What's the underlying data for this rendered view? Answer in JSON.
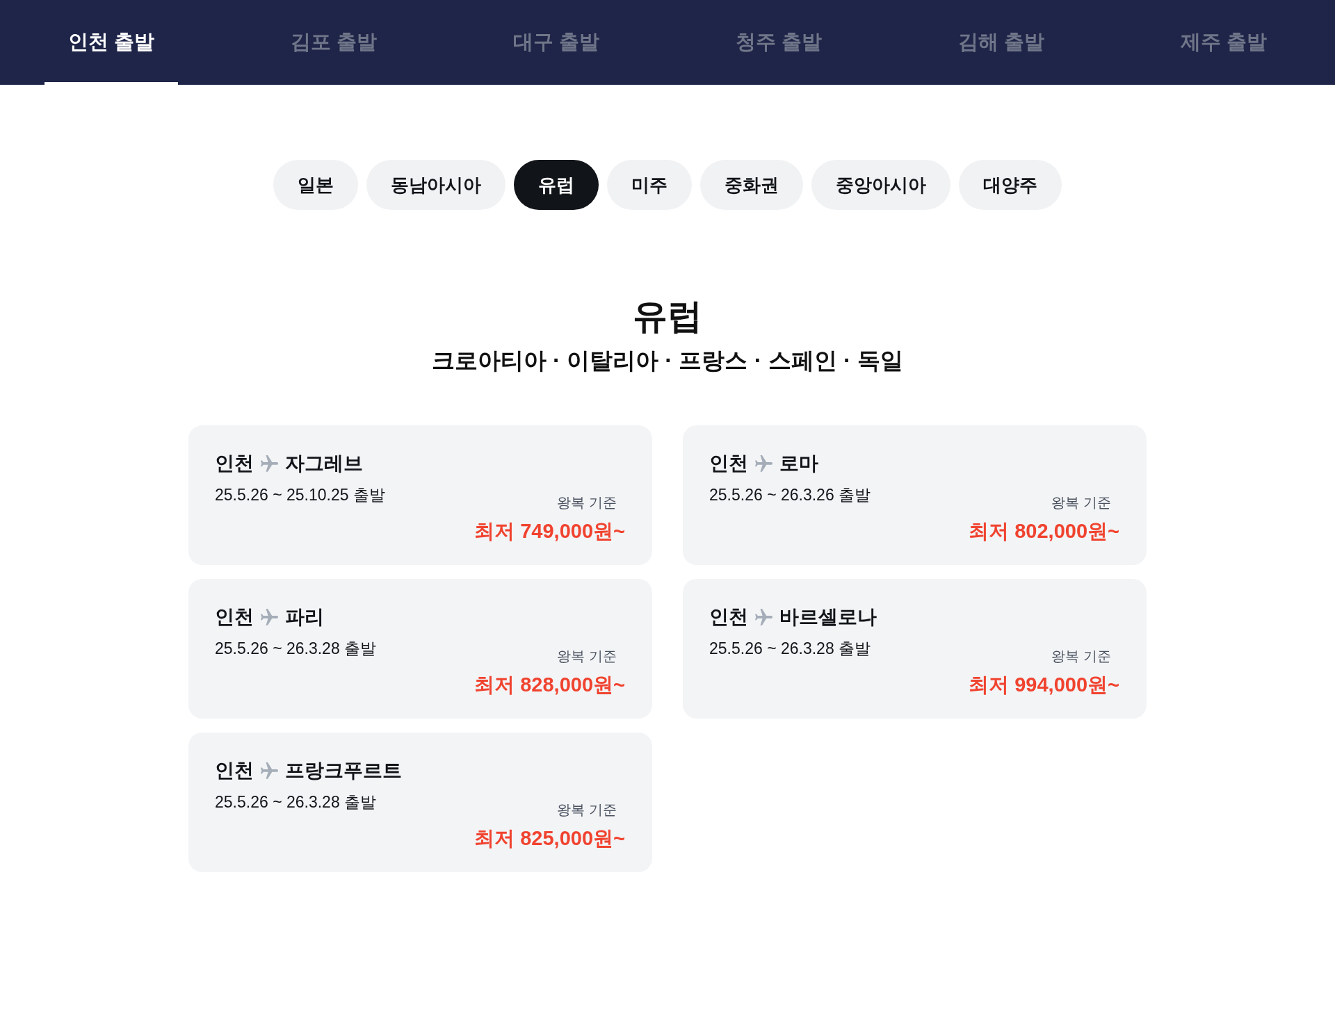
{
  "departure_tabs": [
    {
      "label": "인천 출발",
      "selected": true
    },
    {
      "label": "김포 출발",
      "selected": false
    },
    {
      "label": "대구 출발",
      "selected": false
    },
    {
      "label": "청주 출발",
      "selected": false
    },
    {
      "label": "김해 출발",
      "selected": false
    },
    {
      "label": "제주 출발",
      "selected": false
    }
  ],
  "region_filters": [
    {
      "label": "일본",
      "selected": false
    },
    {
      "label": "동남아시아",
      "selected": false
    },
    {
      "label": "유럽",
      "selected": true
    },
    {
      "label": "미주",
      "selected": false
    },
    {
      "label": "중화권",
      "selected": false
    },
    {
      "label": "중앙아시아",
      "selected": false
    },
    {
      "label": "대양주",
      "selected": false
    }
  ],
  "section": {
    "title": "유럽",
    "subtitle": "크로아티아 · 이탈리아 · 프랑스 · 스페인 · 독일"
  },
  "fares": [
    {
      "origin": "인천",
      "destination": "자그레브",
      "dates": "25.5.26 ~ 25.10.25 출발",
      "basis": "왕복 기준",
      "price": "최저 749,000원~"
    },
    {
      "origin": "인천",
      "destination": "로마",
      "dates": "25.5.26 ~ 26.3.26 출발",
      "basis": "왕복 기준",
      "price": "최저 802,000원~"
    },
    {
      "origin": "인천",
      "destination": "파리",
      "dates": "25.5.26 ~ 26.3.28 출발",
      "basis": "왕복 기준",
      "price": "최저 828,000원~"
    },
    {
      "origin": "인천",
      "destination": "바르셀로나",
      "dates": "25.5.26 ~ 26.3.28 출발",
      "basis": "왕복 기준",
      "price": "최저 994,000원~"
    },
    {
      "origin": "인천",
      "destination": "프랑크푸르트",
      "dates": "25.5.26 ~ 26.3.28 출발",
      "basis": "왕복 기준",
      "price": "최저 825,000원~"
    }
  ]
}
